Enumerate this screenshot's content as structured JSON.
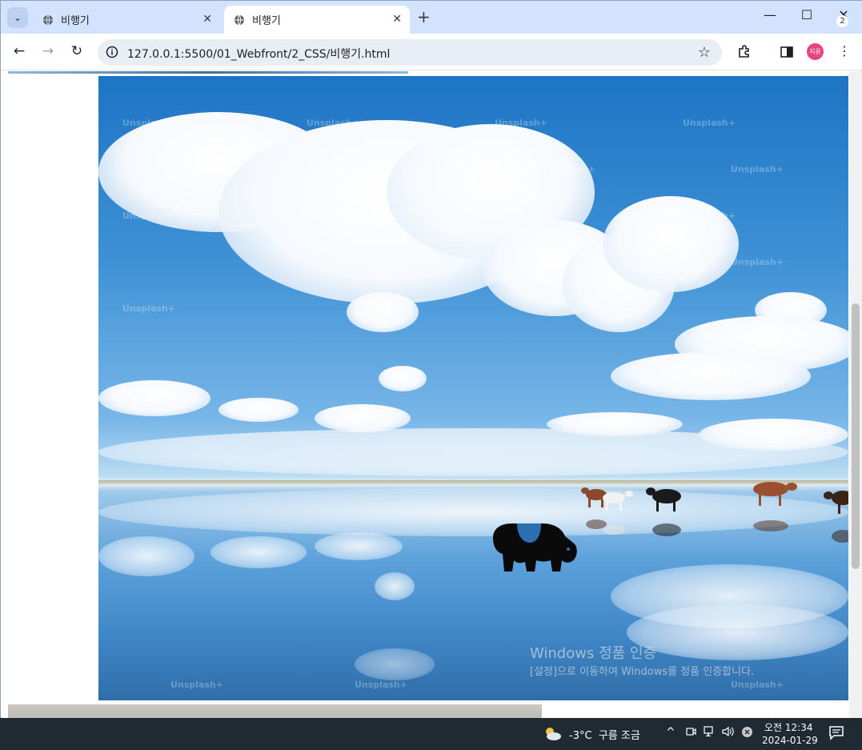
{
  "browser": {
    "tabs": [
      {
        "title": "비행기",
        "close": "✕"
      },
      {
        "title": "비행기",
        "close": "✕"
      }
    ],
    "new_tab": "+",
    "tab_menu": "⌄",
    "window_controls": {
      "minimize": "—",
      "maximize": "☐",
      "close": "✕"
    },
    "nav": {
      "back": "←",
      "forward": "→",
      "reload": "↻"
    },
    "url": "127.0.0.1:5500/01_Webfront/2_CSS/비행기.html",
    "bookmark_star": "☆",
    "profile_initials": "지윤",
    "menu": "⋮"
  },
  "page": {
    "photo": {
      "watermark_text": "Unsplash+"
    },
    "accent_colors": {
      "sky": "#1d74c4",
      "water": "#3f86c7",
      "cloud": "#ffffff",
      "cow_icon": "#000000"
    }
  },
  "os": {
    "activation": {
      "title": "Windows 정품 인증",
      "subtitle": "[설정]으로 이동하여 Windows를 정품 인증합니다."
    },
    "taskbar": {
      "weather_temp": "-3°C",
      "weather_desc": "구름 조금",
      "tray_chevron": "^",
      "time": "오전 12:34",
      "date": "2024-01-29",
      "notification_count": "2"
    }
  }
}
